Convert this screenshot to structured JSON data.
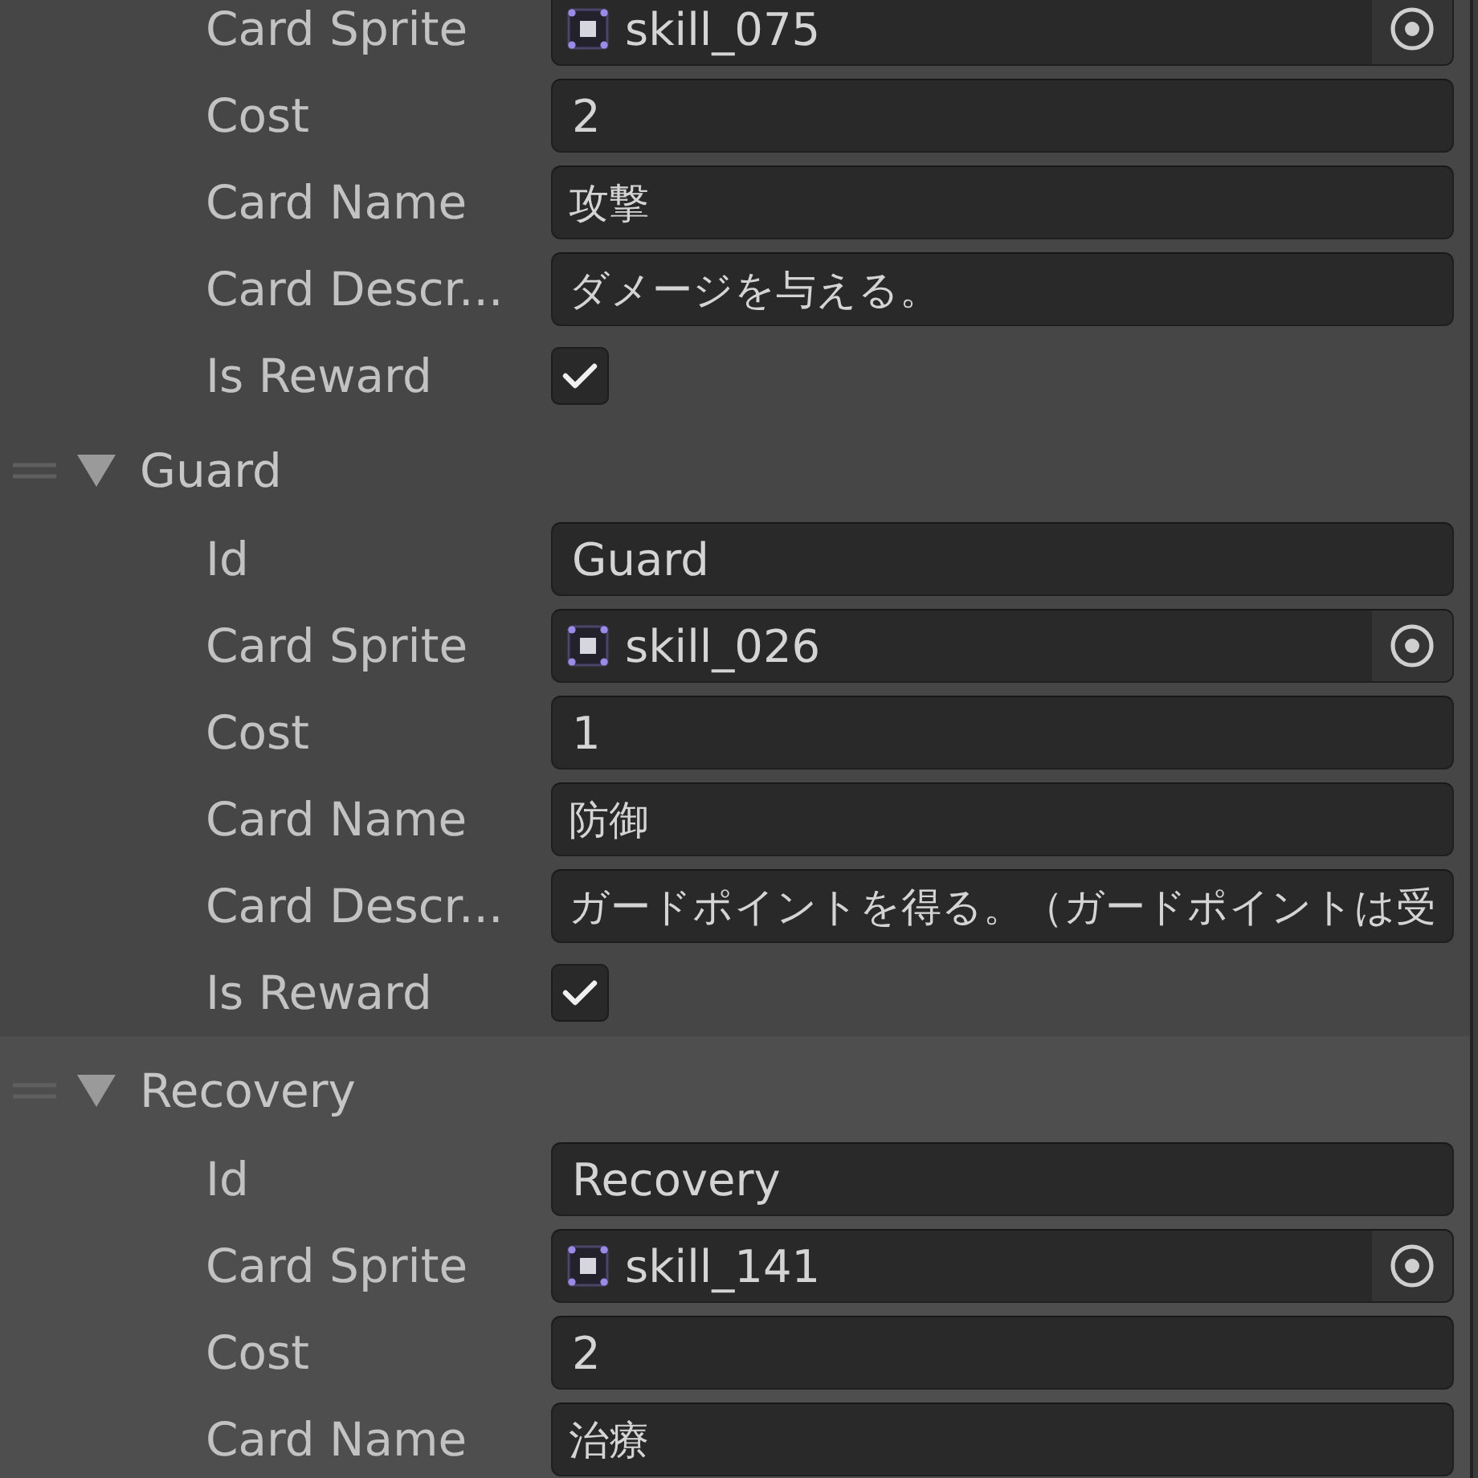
{
  "inspector": {
    "elements": [
      {
        "selected": false,
        "fields": [
          {
            "label": "Card Sprite",
            "kind": "sprite",
            "value": "skill_075"
          },
          {
            "label": "Cost",
            "kind": "number",
            "value": "2"
          },
          {
            "label": "Card Name",
            "kind": "localized",
            "value": "攻撃"
          },
          {
            "label": "Card Descr...",
            "kind": "localized",
            "value": "ダメージを与える。"
          },
          {
            "label": "Is Reward",
            "kind": "toggle",
            "checked": true
          }
        ]
      },
      {
        "title": "Guard",
        "expanded": true,
        "selected": false,
        "fields": [
          {
            "label": "Id",
            "kind": "text",
            "value": "Guard"
          },
          {
            "label": "Card Sprite",
            "kind": "sprite",
            "value": "skill_026"
          },
          {
            "label": "Cost",
            "kind": "number",
            "value": "1"
          },
          {
            "label": "Card Name",
            "kind": "localized",
            "value": "防御"
          },
          {
            "label": "Card Descr...",
            "kind": "localized",
            "value": "ガードポイントを得る。（ガードポイントは受"
          },
          {
            "label": "Is Reward",
            "kind": "toggle",
            "checked": true
          }
        ]
      },
      {
        "title": "Recovery",
        "expanded": true,
        "selected": true,
        "fields": [
          {
            "label": "Id",
            "kind": "text",
            "value": "Recovery"
          },
          {
            "label": "Card Sprite",
            "kind": "sprite",
            "value": "skill_141"
          },
          {
            "label": "Cost",
            "kind": "number",
            "value": "2"
          },
          {
            "label": "Card Name",
            "kind": "localized",
            "value": "治療"
          }
        ]
      }
    ]
  }
}
